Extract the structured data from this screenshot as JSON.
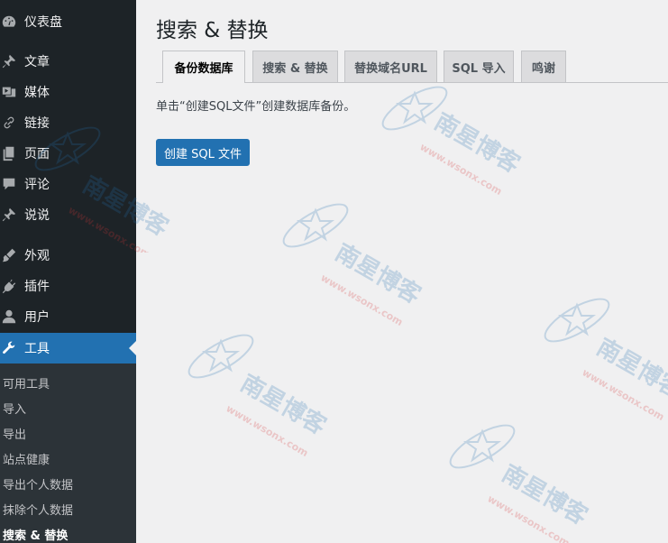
{
  "sidebar": {
    "items": [
      {
        "label": "仪表盘",
        "icon": "dashboard-icon"
      },
      {
        "label": "文章",
        "icon": "pin-icon"
      },
      {
        "label": "媒体",
        "icon": "media-icon"
      },
      {
        "label": "链接",
        "icon": "link-icon"
      },
      {
        "label": "页面",
        "icon": "page-icon"
      },
      {
        "label": "评论",
        "icon": "comment-icon"
      },
      {
        "label": "说说",
        "icon": "pin-icon"
      },
      {
        "label": "外观",
        "icon": "brush-icon"
      },
      {
        "label": "插件",
        "icon": "plug-icon"
      },
      {
        "label": "用户",
        "icon": "user-icon"
      },
      {
        "label": "工具",
        "icon": "wrench-icon"
      }
    ],
    "active_item": "工具",
    "submenu": [
      "可用工具",
      "导入",
      "导出",
      "站点健康",
      "导出个人数据",
      "抹除个人数据",
      "搜索 & 替换"
    ],
    "submenu_current": "搜索 & 替换"
  },
  "main": {
    "title": "搜索 & 替换",
    "tabs": [
      {
        "label": "备份数据库",
        "active": true
      },
      {
        "label": "搜索 & 替换",
        "active": false
      },
      {
        "label": "替换域名URL",
        "active": false
      },
      {
        "label": "SQL 导入",
        "active": false
      },
      {
        "label": "鸣谢",
        "active": false
      }
    ],
    "description": "单击“创建SQL文件”创建数据库备份。",
    "create_button": "创建 SQL 文件"
  },
  "watermark": {
    "text": "南星博客",
    "url": "www.wsonx.com"
  },
  "colors": {
    "sidebar_bg": "#1d2327",
    "accent": "#2271b1",
    "page_bg": "#f0f0f1"
  }
}
